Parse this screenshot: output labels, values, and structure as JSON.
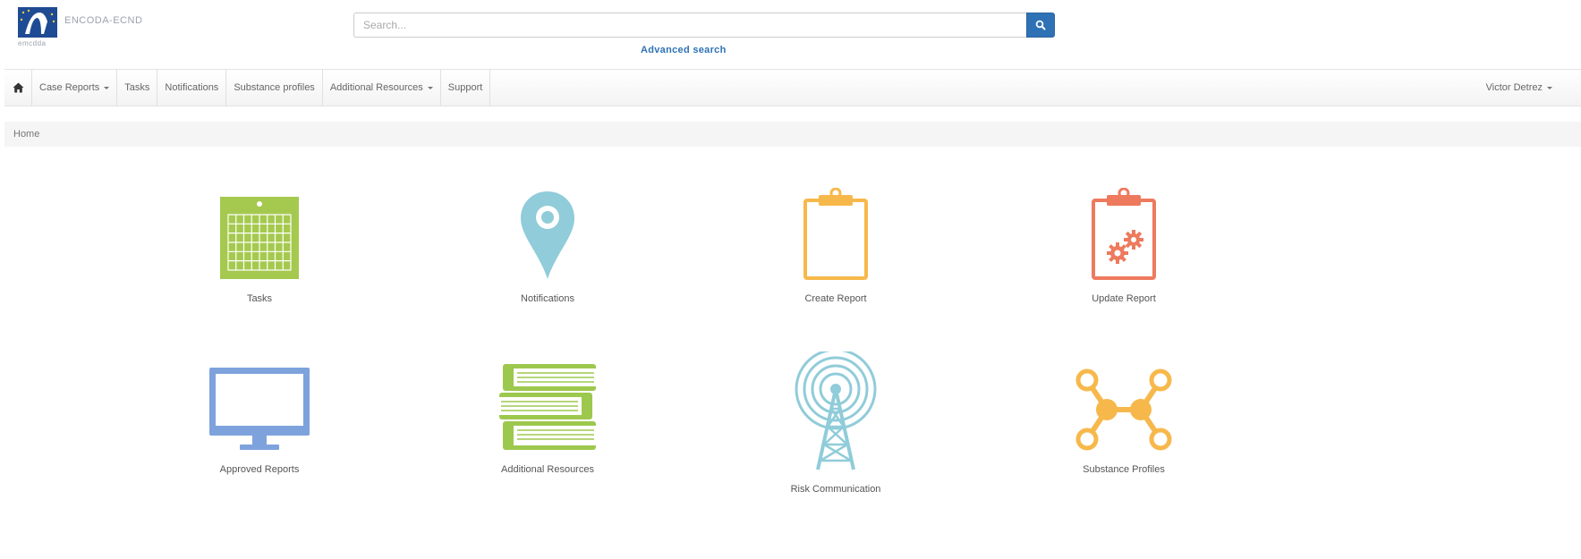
{
  "brand": {
    "name": "ENCODA-ECND",
    "tagline": "emcdda"
  },
  "search": {
    "placeholder": "Search...",
    "value": "",
    "advanced_label": "Advanced search"
  },
  "nav": {
    "items": [
      {
        "label": "Case Reports",
        "dropdown": true
      },
      {
        "label": "Tasks",
        "dropdown": false
      },
      {
        "label": "Notifications",
        "dropdown": false
      },
      {
        "label": "Substance profiles",
        "dropdown": false
      },
      {
        "label": "Additional Resources",
        "dropdown": true
      },
      {
        "label": "Support",
        "dropdown": false
      }
    ],
    "user": "Victor Detrez"
  },
  "breadcrumb": [
    "Home"
  ],
  "tiles": [
    {
      "label": "Tasks",
      "icon": "calendar-icon",
      "color": "#a5c94f"
    },
    {
      "label": "Notifications",
      "icon": "map-pin-icon",
      "color": "#90ccd9"
    },
    {
      "label": "Create Report",
      "icon": "clipboard-icon",
      "color": "#f7b84b"
    },
    {
      "label": "Update Report",
      "icon": "clipboard-gears-icon",
      "color": "#ee7a5e"
    },
    {
      "label": "Approved Reports",
      "icon": "monitor-icon",
      "color": "#7ea3dc"
    },
    {
      "label": "Additional Resources",
      "icon": "books-icon",
      "color": "#9dc84e"
    },
    {
      "label": "Risk Communication",
      "icon": "radio-tower-icon",
      "color": "#90ccd9"
    },
    {
      "label": "Substance Profiles",
      "icon": "molecule-icon",
      "color": "#f7b84b"
    }
  ],
  "colors": {
    "accent": "#2f71b5",
    "navbar_bg": "#f6f6f6",
    "breadcrumb_bg": "#f5f5f5"
  }
}
